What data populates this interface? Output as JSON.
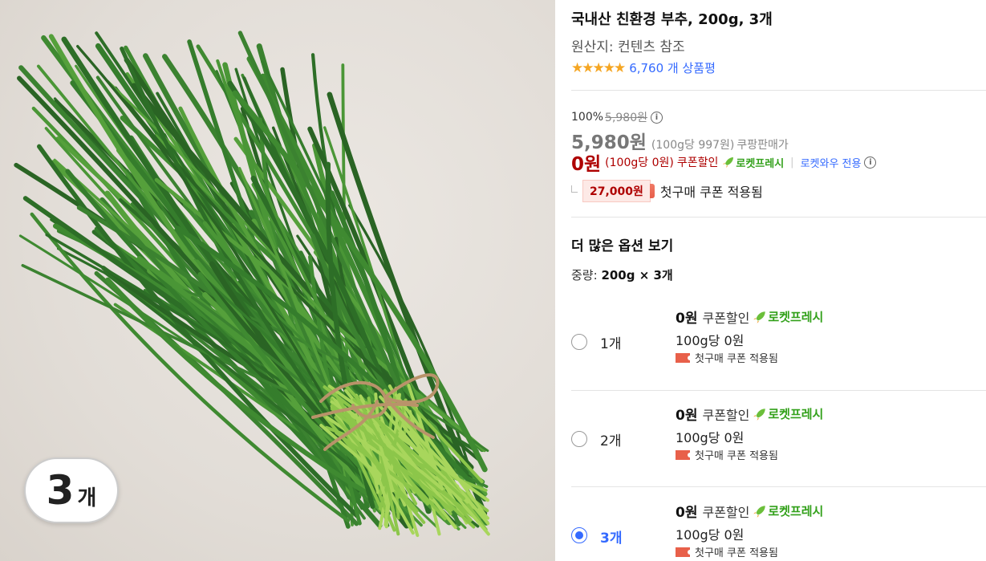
{
  "image": {
    "badge_number": "3",
    "badge_unit": "개",
    "alt": "chives-bundle-photo"
  },
  "product": {
    "title": "국내산 친환경 부추, 200g, 3개",
    "origin": "원산지: 컨텐츠 참조",
    "stars": "★★★★★",
    "rating_fraction": 1.0,
    "review_count": "6,760 개 상품평"
  },
  "price": {
    "discount_rate": "100%",
    "original_price": "5,980원",
    "sale_price": "5,980원",
    "sale_unit_price": "(100g당 997원)",
    "seller_label": "쿠팡판매가",
    "coupon_price": "0원",
    "coupon_unit_price": "(100g당 0원)",
    "coupon_label": "쿠폰할인",
    "rocket_label": "로켓프레시",
    "wow_label": "로켓와우 전용",
    "first_coupon_amount": "27,000원",
    "first_coupon_text": "첫구매 쿠폰 적용됨"
  },
  "options": {
    "title": "더 많은 옵션 보기",
    "weight_label": "중량:",
    "weight_value": "200g × 3개",
    "items": [
      {
        "label": "1개",
        "price": "0원",
        "coupon_label": "쿠폰할인",
        "rocket": "로켓프레시",
        "unit_price": "100g당 0원",
        "coupon_text": "첫구매 쿠폰 적용됨",
        "selected": false
      },
      {
        "label": "2개",
        "price": "0원",
        "coupon_label": "쿠폰할인",
        "rocket": "로켓프레시",
        "unit_price": "100g당 0원",
        "coupon_text": "첫구매 쿠폰 적용됨",
        "selected": false
      },
      {
        "label": "3개",
        "price": "0원",
        "coupon_label": "쿠폰할인",
        "rocket": "로켓프레시",
        "unit_price": "100g당 0원",
        "coupon_text": "첫구매 쿠폰 적용됨",
        "selected": true
      }
    ]
  },
  "colors": {
    "accent": "#346aff",
    "price_red": "#ae0000",
    "rocket_green": "#33a11b",
    "star": "#f5a623"
  }
}
